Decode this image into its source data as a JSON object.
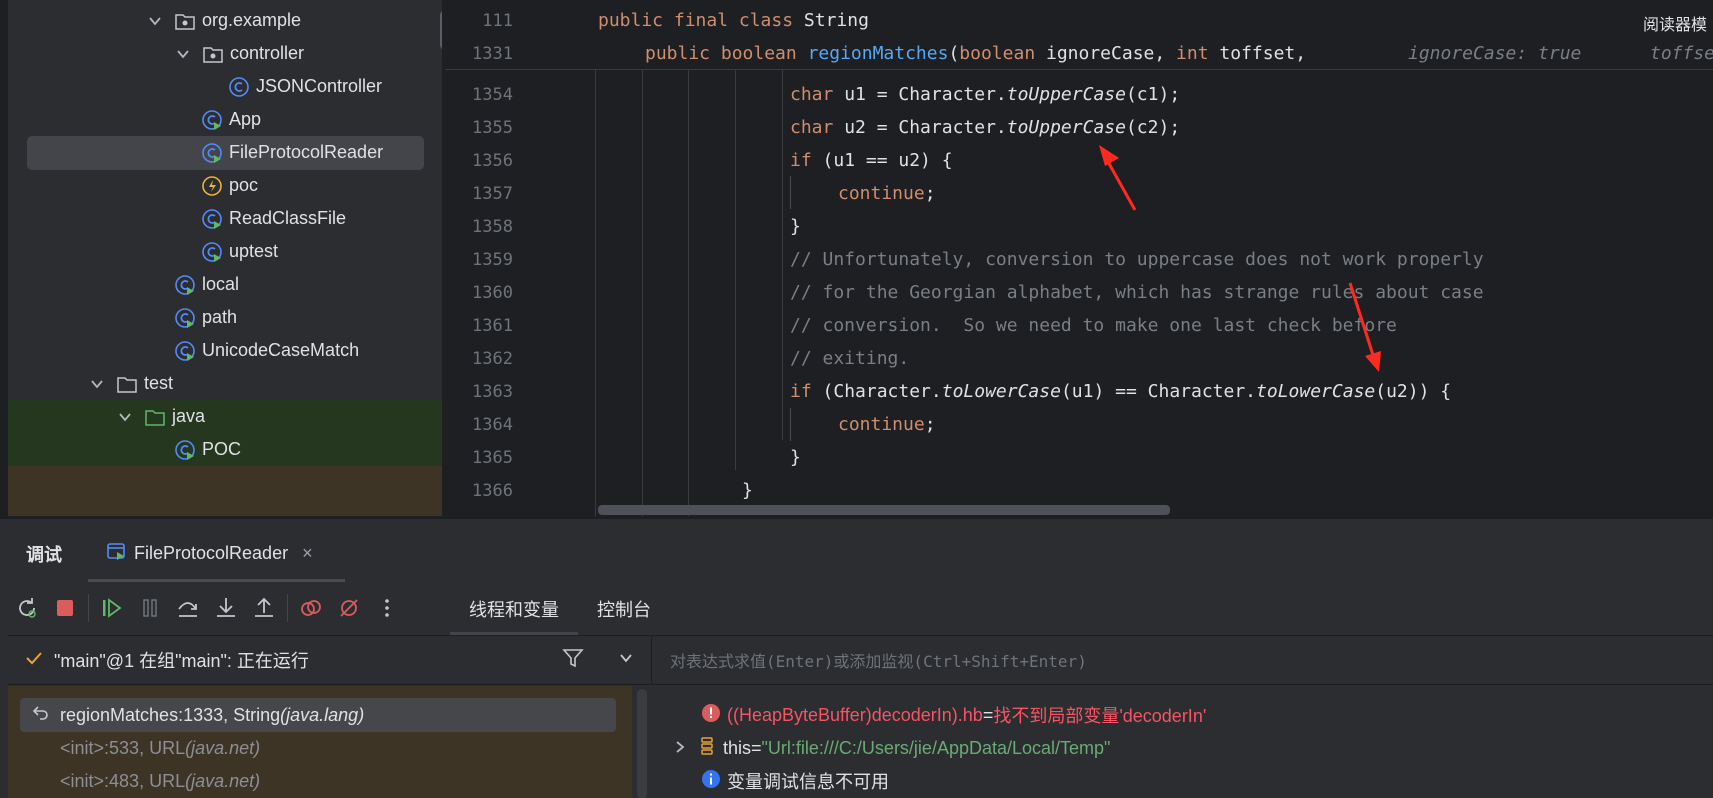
{
  "tree": {
    "items": [
      {
        "label": "org.example",
        "icon": "package-icon",
        "expanded": true
      },
      {
        "label": "controller",
        "icon": "package-icon",
        "expanded": true
      },
      {
        "label": "JSONController",
        "icon": "class-icon"
      },
      {
        "label": "App",
        "icon": "runnable-class-icon"
      },
      {
        "label": "FileProtocolReader",
        "icon": "runnable-class-icon",
        "selected": true
      },
      {
        "label": "poc",
        "icon": "function-icon"
      },
      {
        "label": "ReadClassFile",
        "icon": "runnable-class-icon"
      },
      {
        "label": "uptest",
        "icon": "runnable-class-icon"
      },
      {
        "label": "local",
        "icon": "runnable-class-icon"
      },
      {
        "label": "path",
        "icon": "runnable-class-icon"
      },
      {
        "label": "UnicodeCaseMatch",
        "icon": "runnable-class-icon"
      },
      {
        "label": "test",
        "icon": "folder-icon",
        "expanded": true
      },
      {
        "label": "java",
        "icon": "test-folder-icon",
        "expanded": true
      },
      {
        "label": "POC",
        "icon": "runnable-class-icon"
      }
    ]
  },
  "editor": {
    "reader_mode_label": "阅读器模",
    "sticky": [
      {
        "line": "111",
        "kw": "public final class",
        "rest": " String"
      },
      {
        "line": "1331",
        "kw1": "public boolean",
        "fn": "regionMatches",
        "p1": "(",
        "kw2": "boolean",
        "p2": " ignoreCase, ",
        "kw3": "int",
        "p3": " toffset,",
        "hint1": "ignoreCase: true",
        "hint2": "toffset"
      }
    ],
    "lines": [
      {
        "n": "1354",
        "kw": "char",
        "a": " u1 = Character.",
        "it": "toUpperCase",
        "b": "(c1);"
      },
      {
        "n": "1355",
        "kw": "char",
        "a": " u2 = Character.",
        "it": "toUpperCase",
        "b": "(c2);"
      },
      {
        "n": "1356",
        "kw": "if",
        "a": " (u1 == u2) {"
      },
      {
        "n": "1357",
        "kw": "continue",
        "a": ";"
      },
      {
        "n": "1358",
        "a": "}"
      },
      {
        "n": "1359",
        "cm": "// Unfortunately, conversion to uppercase does not work properly"
      },
      {
        "n": "1360",
        "cm": "// for the Georgian alphabet, which has strange rules about case"
      },
      {
        "n": "1361",
        "cm": "// conversion.  So we need to make one last check before"
      },
      {
        "n": "1362",
        "cm": "// exiting."
      },
      {
        "n": "1363",
        "kw": "if",
        "a": " (Character.",
        "it": "toLowerCase",
        "b": "(u1) == Character.",
        "it2": "toLowerCase",
        "c": "(u2)) {"
      },
      {
        "n": "1364",
        "kw": "continue",
        "a": ";"
      },
      {
        "n": "1365",
        "a": "}"
      },
      {
        "n": "1366",
        "a": "}"
      }
    ]
  },
  "debug": {
    "title": "调试",
    "session_tab": "FileProtocolReader",
    "close_glyph": "×",
    "subtabs": [
      "线程和变量",
      "控制台"
    ],
    "thread_status": "\"main\"@1 在组\"main\": 正在运行",
    "eval_placeholder": "对表达式求值(Enter)或添加监视(Ctrl+Shift+Enter)",
    "frames": [
      {
        "method": "regionMatches:1333, String ",
        "pkg": "(java.lang)"
      },
      {
        "method": "<init>:533, URL ",
        "pkg": "(java.net)"
      },
      {
        "method": "<init>:483, URL ",
        "pkg": "(java.net)"
      }
    ],
    "variables": [
      {
        "name": "((HeapByteBuffer)decoderIn).hb",
        "eq": " = ",
        "value": "找不到局部变量'decoderIn'"
      },
      {
        "name": "this",
        "eq": " = ",
        "value": "\"Url:file:///C:/Users/jie/AppData/Local/Temp\""
      },
      {
        "info": "变量调试信息不可用"
      }
    ]
  },
  "colors": {
    "accent": "#3574f0",
    "annotation_arrow": "#ff2a1f",
    "keyword": "#cf8e6d",
    "function": "#56a8f5",
    "comment": "#7a7e85",
    "string": "#6aab73",
    "error": "#f75464"
  }
}
